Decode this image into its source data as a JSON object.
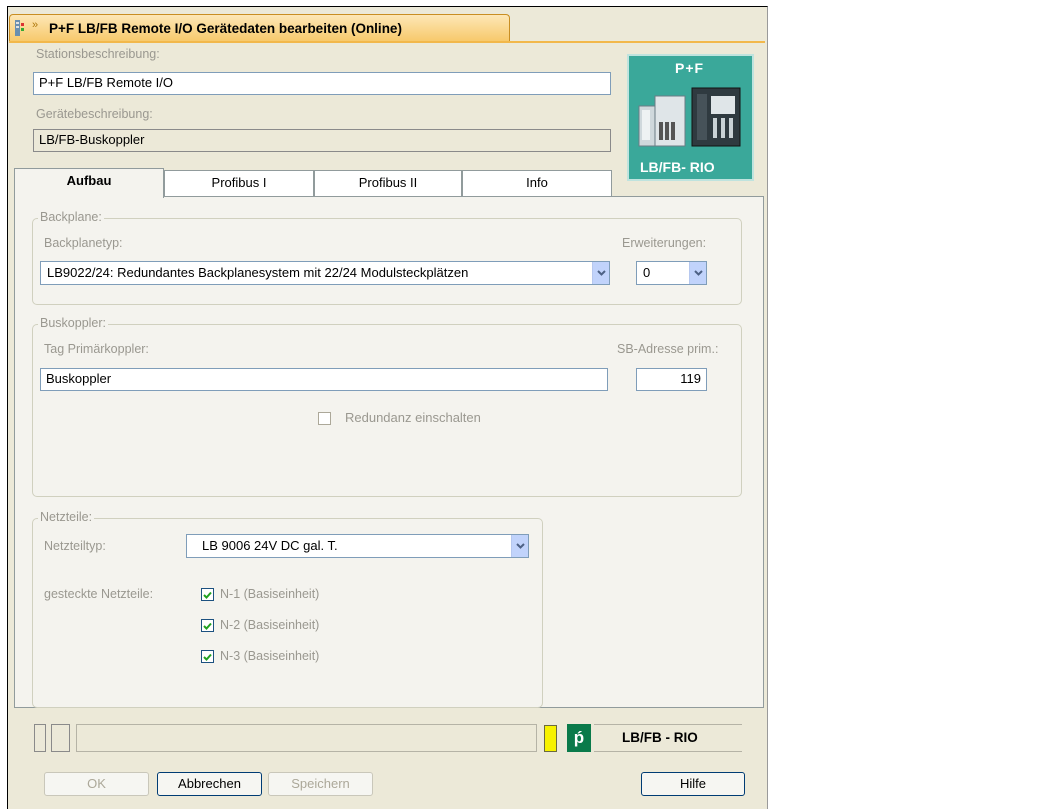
{
  "window": {
    "title": "P+F LB/FB Remote I/O Gerätedaten bearbeiten (Online)"
  },
  "station": {
    "label": "Stationsbeschreibung:",
    "value": "P+F LB/FB Remote I/O"
  },
  "device": {
    "label": "Gerätebeschreibung:",
    "value": "LB/FB-Buskoppler"
  },
  "logo": {
    "top_text": "P+F",
    "bottom_text": "LB/FB- RIO"
  },
  "tabs": [
    {
      "label": "Aufbau",
      "active": true
    },
    {
      "label": "Profibus I"
    },
    {
      "label": "Profibus II"
    },
    {
      "label": "Info"
    }
  ],
  "backplane": {
    "legend": "Backplane:",
    "type_label": "Backplanetyp:",
    "type_value": "LB9022/24: Redundantes Backplanesystem mit 22/24 Modulsteckplätzen",
    "ext_label": "Erweiterungen:",
    "ext_value": "0"
  },
  "buskoppler": {
    "legend": "Buskoppler:",
    "tag_label": "Tag Primärkoppler:",
    "tag_value": "Buskoppler",
    "addr_label": "SB-Adresse prim.:",
    "addr_value": "119",
    "redundancy_label": "Redundanz einschalten"
  },
  "netzteile": {
    "legend": "Netzteile:",
    "type_label": "Netzteiltyp:",
    "type_value": "LB 9006 24V DC gal. T.",
    "plugged_label": "gesteckte Netzteile:",
    "items": [
      {
        "label": "N-1 (Basiseinheit)",
        "checked": true
      },
      {
        "label": "N-2 (Basiseinheit)",
        "checked": true
      },
      {
        "label": "N-3 (Basiseinheit)",
        "checked": true
      }
    ]
  },
  "statusbar": {
    "brand": "LB/FB - RIO",
    "pf_glyph": "ṕ"
  },
  "buttons": {
    "ok": "OK",
    "cancel": "Abbrechen",
    "save": "Speichern",
    "help": "Hilfe"
  },
  "colors": {
    "tab_orange": "#f2b84b",
    "logo_teal": "#3aa89a",
    "status_yellow": "#f7f200",
    "status_green": "#0a7a4a"
  }
}
